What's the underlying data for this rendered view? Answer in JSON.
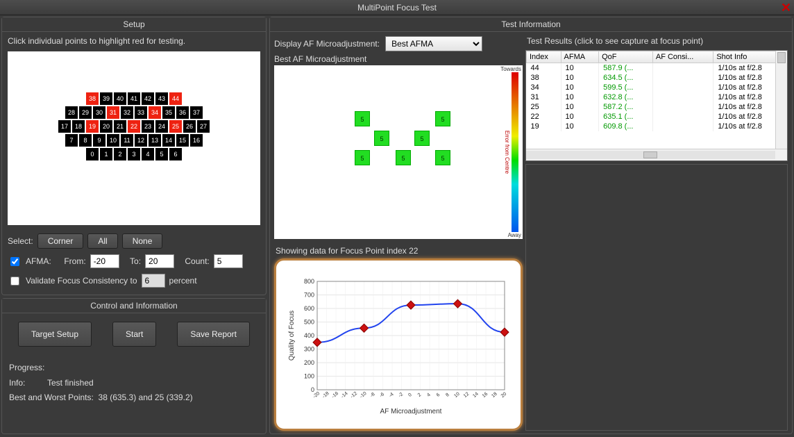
{
  "window": {
    "title": "MultiPoint Focus Test"
  },
  "setup": {
    "header": "Setup",
    "instruction": "Click individual points to highlight red for testing.",
    "select_label": "Select:",
    "btn_corner": "Corner",
    "btn_all": "All",
    "btn_none": "None",
    "afma_label": "AFMA:",
    "afma_checked": true,
    "from_label": "From:",
    "from_value": "-20",
    "to_label": "To:",
    "to_value": "20",
    "count_label": "Count:",
    "count_value": "5",
    "validate_checked": false,
    "validate_label": "Validate Focus Consistency to",
    "validate_value": "6",
    "validate_suffix": "percent",
    "point_rows": [
      [
        {
          "n": "38",
          "s": 1
        },
        {
          "n": "39"
        },
        {
          "n": "40"
        },
        {
          "n": "41"
        },
        {
          "n": "42"
        },
        {
          "n": "43"
        },
        {
          "n": "44",
          "s": 1
        }
      ],
      [
        {
          "n": "28"
        },
        {
          "n": "29"
        },
        {
          "n": "30"
        },
        {
          "n": "31",
          "s": 1
        },
        {
          "n": "32"
        },
        {
          "n": "33"
        },
        {
          "n": "34",
          "s": 1
        },
        {
          "n": "35"
        },
        {
          "n": "36"
        },
        {
          "n": "37"
        }
      ],
      [
        {
          "n": "17"
        },
        {
          "n": "18"
        },
        {
          "n": "19",
          "s": 1
        },
        {
          "n": "20"
        },
        {
          "n": "21"
        },
        {
          "n": "22",
          "s": 1
        },
        {
          "n": "23"
        },
        {
          "n": "24"
        },
        {
          "n": "25",
          "s": 1
        },
        {
          "n": "26"
        },
        {
          "n": "27"
        }
      ],
      [
        {
          "n": "7"
        },
        {
          "n": "8"
        },
        {
          "n": "9"
        },
        {
          "n": "10"
        },
        {
          "n": "11"
        },
        {
          "n": "12"
        },
        {
          "n": "13"
        },
        {
          "n": "14"
        },
        {
          "n": "15"
        },
        {
          "n": "16"
        }
      ],
      [
        {
          "n": "0"
        },
        {
          "n": "1"
        },
        {
          "n": "2"
        },
        {
          "n": "3"
        },
        {
          "n": "4"
        },
        {
          "n": "5"
        },
        {
          "n": "6"
        }
      ]
    ]
  },
  "control": {
    "header": "Control and Information",
    "btn_target": "Target Setup",
    "btn_start": "Start",
    "btn_save": "Save Report",
    "progress_label": "Progress:",
    "info_label": "Info:",
    "info_value": "Test finished",
    "bestworst_label": "Best and Worst Points:",
    "bestworst_value": "38 (635.3) and 25 (339.2)"
  },
  "testinfo": {
    "header": "Test Information",
    "display_label": "Display AF Microadjustment:",
    "display_value": "Best AFMA",
    "best_label": "Best AF Microadjustment",
    "grad_top": "Towards",
    "grad_mid": "Error from Centre",
    "grad_bot": "Away",
    "af_points": [
      {
        "v": "5",
        "x": 116,
        "y": 66
      },
      {
        "v": "5",
        "x": 232,
        "y": 66
      },
      {
        "v": "5",
        "x": 144,
        "y": 94
      },
      {
        "v": "5",
        "x": 202,
        "y": 94
      },
      {
        "v": "5",
        "x": 116,
        "y": 122
      },
      {
        "v": "5",
        "x": 175,
        "y": 122
      },
      {
        "v": "5",
        "x": 232,
        "y": 122
      }
    ],
    "chart_title": "Showing data for Focus Point index 22"
  },
  "chart_data": {
    "type": "line",
    "title": "",
    "xlabel": "AF Microadjustment",
    "ylabel": "Quality of Focus",
    "x": [
      -20,
      -10,
      0,
      10,
      20
    ],
    "y": [
      350,
      455,
      625,
      635,
      425
    ],
    "ylim": [
      0,
      800
    ],
    "xlim": [
      -20,
      20
    ],
    "yticks": [
      0,
      100,
      200,
      300,
      400,
      500,
      600,
      700,
      800
    ]
  },
  "results": {
    "header": "Test Results (click to see capture at focus point)",
    "columns": [
      "Index",
      "AFMA",
      "QoF",
      "AF Consi...",
      "Shot Info"
    ],
    "rows": [
      {
        "index": "44",
        "afma": "10",
        "qof": "587.9 (...",
        "cons": "",
        "shot": "1/10s at f/2.8"
      },
      {
        "index": "38",
        "afma": "10",
        "qof": "634.5 (...",
        "cons": "",
        "shot": "1/10s at f/2.8"
      },
      {
        "index": "34",
        "afma": "10",
        "qof": "599.5 (...",
        "cons": "",
        "shot": "1/10s at f/2.8"
      },
      {
        "index": "31",
        "afma": "10",
        "qof": "632.8 (...",
        "cons": "",
        "shot": "1/10s at f/2.8"
      },
      {
        "index": "25",
        "afma": "10",
        "qof": "587.2 (...",
        "cons": "",
        "shot": "1/10s at f/2.8"
      },
      {
        "index": "22",
        "afma": "10",
        "qof": "635.1 (...",
        "cons": "",
        "shot": "1/10s at f/2.8"
      },
      {
        "index": "19",
        "afma": "10",
        "qof": "609.8 (...",
        "cons": "",
        "shot": "1/10s at f/2.8"
      }
    ]
  }
}
